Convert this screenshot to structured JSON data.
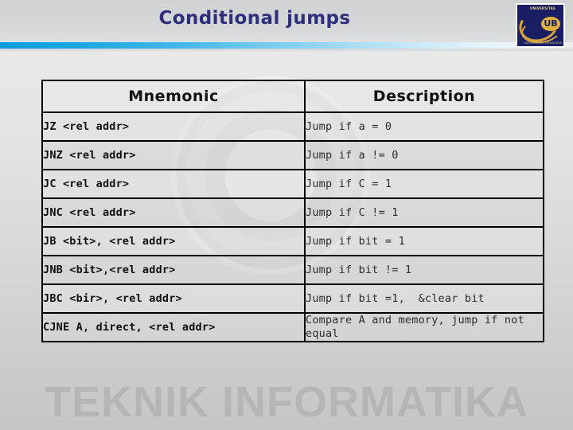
{
  "slide": {
    "title": "Conditional jumps",
    "accent_color": "#0d9ee0",
    "title_color": "#2e2e7a",
    "background_watermark": "TEKNIK INFORMATIKA"
  },
  "logo": {
    "name": "UB",
    "top_text": "UNIVERSITAS",
    "bottom_text": "UNIVERSITAS BRAWIJAYA"
  },
  "table": {
    "columns": [
      "Mnemonic",
      "Description"
    ],
    "rows": [
      {
        "mnemonic": "JZ <rel addr>",
        "description": "Jump if a = 0"
      },
      {
        "mnemonic": "JNZ <rel addr>",
        "description": "Jump if a != 0"
      },
      {
        "mnemonic": "JC <rel addr>",
        "description": "Jump if C = 1"
      },
      {
        "mnemonic": "JNC <rel addr>",
        "description": "Jump if C != 1"
      },
      {
        "mnemonic": "JB <bit>, <rel addr>",
        "description": "Jump if bit = 1"
      },
      {
        "mnemonic": "JNB <bit>,<rel addr>",
        "description": "Jump if bit != 1"
      },
      {
        "mnemonic": "JBC <bir>, <rel addr>",
        "description": "Jump if bit =1,  &clear bit"
      },
      {
        "mnemonic": "CJNE A, direct, <rel addr>",
        "description": "Compare A and memory, jump if not equal"
      }
    ]
  }
}
